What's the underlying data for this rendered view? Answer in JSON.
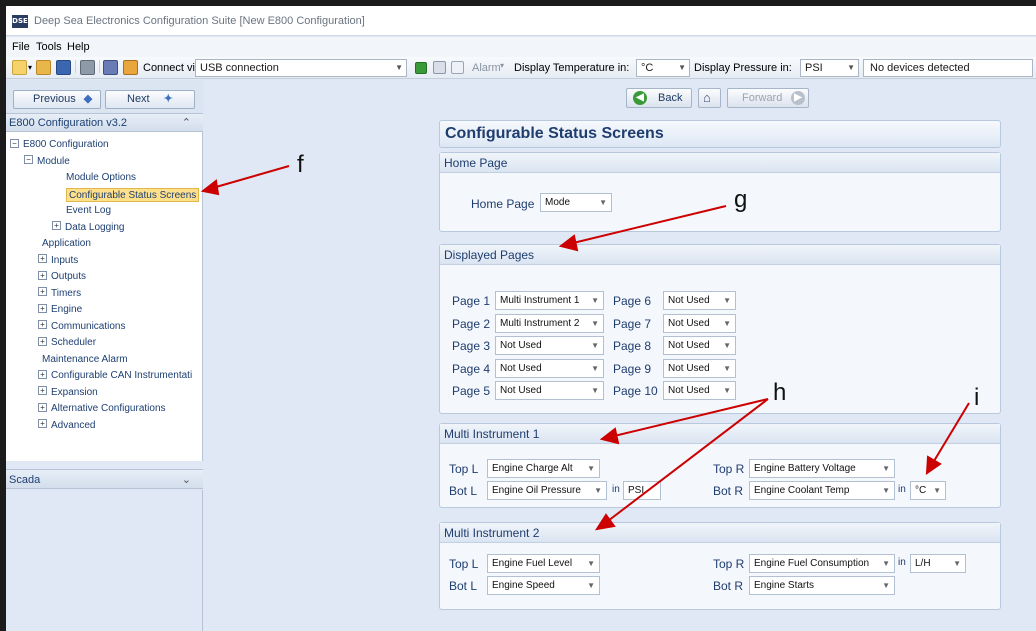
{
  "window": {
    "title": "Deep Sea Electronics Configuration Suite [New E800 Configuration]",
    "app_icon_text": "DSE"
  },
  "menu": [
    "File",
    "Tools",
    "Help"
  ],
  "toolbar": {
    "connect_label": "Connect via",
    "connect_value": "USB connection",
    "alarm_label": "Alarm",
    "temp_label": "Display Temperature in:",
    "temp_value": "°C",
    "pressure_label": "Display Pressure in:",
    "pressure_value": "PSI",
    "status": "No devices detected"
  },
  "nav": {
    "previous": "Previous",
    "next": "Next",
    "back": "Back",
    "forward": "Forward"
  },
  "tree": {
    "header": "E800 Configuration v3.2",
    "items": [
      {
        "label": "E800 Configuration",
        "exp": "−"
      },
      {
        "label": "Module",
        "exp": "−"
      },
      {
        "label": "Module Options",
        "exp": ""
      },
      {
        "label": "Configurable Status Screens",
        "exp": ""
      },
      {
        "label": "Event Log",
        "exp": ""
      },
      {
        "label": "Data Logging",
        "exp": "+"
      },
      {
        "label": "Application",
        "exp": ""
      },
      {
        "label": "Inputs",
        "exp": "+"
      },
      {
        "label": "Outputs",
        "exp": "+"
      },
      {
        "label": "Timers",
        "exp": "+"
      },
      {
        "label": "Engine",
        "exp": "+"
      },
      {
        "label": "Communications",
        "exp": "+"
      },
      {
        "label": "Scheduler",
        "exp": "+"
      },
      {
        "label": "Maintenance Alarm",
        "exp": ""
      },
      {
        "label": "Configurable CAN Instrumentati",
        "exp": "+"
      },
      {
        "label": "Expansion",
        "exp": "+"
      },
      {
        "label": "Alternative Configurations",
        "exp": "+"
      },
      {
        "label": "Advanced",
        "exp": "+"
      }
    ],
    "scada": "Scada"
  },
  "page": {
    "title": "Configurable Status Screens",
    "home": {
      "header": "Home Page",
      "label": "Home Page",
      "value": "Mode"
    },
    "displayed": {
      "header": "Displayed Pages",
      "pages": [
        {
          "label": "Page 1",
          "value": "Multi Instrument 1"
        },
        {
          "label": "Page 2",
          "value": "Multi Instrument 2"
        },
        {
          "label": "Page 3",
          "value": "Not Used"
        },
        {
          "label": "Page 4",
          "value": "Not Used"
        },
        {
          "label": "Page 5",
          "value": "Not Used"
        },
        {
          "label": "Page 6",
          "value": "Not Used"
        },
        {
          "label": "Page 7",
          "value": "Not Used"
        },
        {
          "label": "Page 8",
          "value": "Not Used"
        },
        {
          "label": "Page 9",
          "value": "Not Used"
        },
        {
          "label": "Page 10",
          "value": "Not Used"
        }
      ]
    },
    "mi1": {
      "header": "Multi Instrument 1",
      "top_l_label": "Top L",
      "top_l": "Engine Charge Alt",
      "bot_l_label": "Bot L",
      "bot_l": "Engine Oil Pressure",
      "bot_l_in": "in",
      "bot_l_unit": "PSI",
      "top_r_label": "Top R",
      "top_r": "Engine Battery Voltage",
      "bot_r_label": "Bot R",
      "bot_r": "Engine Coolant Temp",
      "bot_r_in": "in",
      "bot_r_unit": "°C"
    },
    "mi2": {
      "header": "Multi Instrument 2",
      "top_l_label": "Top L",
      "top_l": "Engine Fuel Level",
      "bot_l_label": "Bot L",
      "bot_l": "Engine Speed",
      "top_r_label": "Top R",
      "top_r": "Engine Fuel Consumption",
      "top_r_in": "in",
      "top_r_unit": "L/H",
      "bot_r_label": "Bot R",
      "bot_r": "Engine Starts"
    }
  },
  "annotations": {
    "f": "f",
    "g": "g",
    "h": "h",
    "i": "i"
  },
  "colors": {
    "accent": "#1f3d6f",
    "selected": "#ffe08a",
    "annotation": "#cc0000"
  }
}
